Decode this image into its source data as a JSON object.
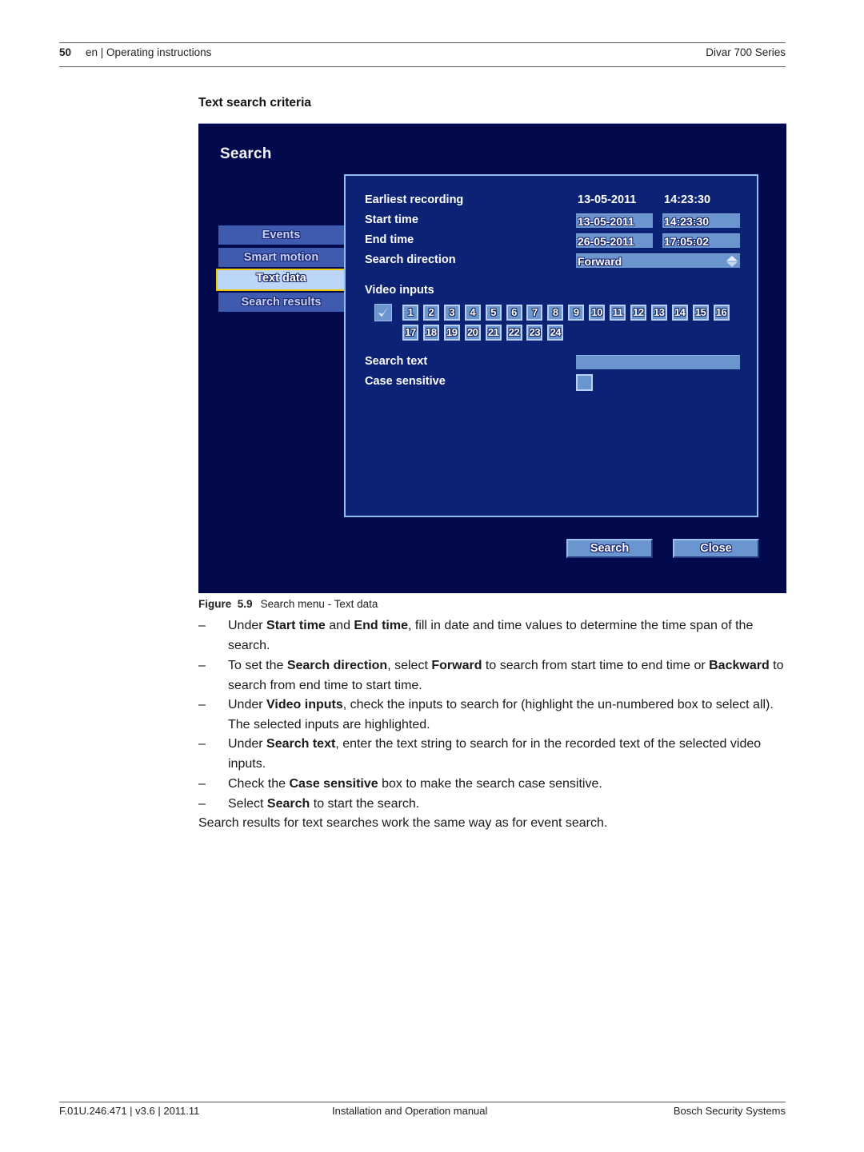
{
  "header": {
    "page_number": "50",
    "section": "en | Operating instructions",
    "product": "Divar 700 Series"
  },
  "section_title": "Text search criteria",
  "dvr_screen": {
    "title": "Search",
    "tabs": [
      {
        "label": "Events",
        "active": false
      },
      {
        "label": "Smart motion",
        "active": false
      },
      {
        "label": "Text data",
        "active": true
      },
      {
        "label": "Search results",
        "active": false
      }
    ],
    "earliest_recording": {
      "label": "Earliest recording",
      "date": "13-05-2011",
      "time": "14:23:30"
    },
    "start_time": {
      "label": "Start time",
      "date": "13-05-2011",
      "time": "14:23:30"
    },
    "end_time": {
      "label": "End time",
      "date": "26-05-2011",
      "time": "17:05:02"
    },
    "search_direction": {
      "label": "Search direction",
      "value": "Forward"
    },
    "video_inputs": {
      "label": "Video inputs",
      "select_all_checked": true,
      "inputs": [
        "1",
        "2",
        "3",
        "4",
        "5",
        "6",
        "7",
        "8",
        "9",
        "10",
        "11",
        "12",
        "13",
        "14",
        "15",
        "16",
        "17",
        "18",
        "19",
        "20",
        "21",
        "22",
        "23",
        "24"
      ]
    },
    "search_text": {
      "label": "Search text",
      "value": ""
    },
    "case_sensitive": {
      "label": "Case sensitive",
      "checked": false
    },
    "buttons": {
      "search": "Search",
      "close": "Close"
    },
    "colors": {
      "background": "#020a4d",
      "panel": "#0c2275",
      "field": "#6b95ce",
      "highlight_border": "#f0c800"
    }
  },
  "figure_caption": {
    "label": "Figure",
    "number": "5.9",
    "text": "Search menu - Text data"
  },
  "bullets": [
    {
      "parts": [
        {
          "t": "Under "
        },
        {
          "b": "Start time"
        },
        {
          "t": " and "
        },
        {
          "b": "End time"
        },
        {
          "t": ", fill in date and time values to determine the time span of the search."
        }
      ]
    },
    {
      "parts": [
        {
          "t": "To set the "
        },
        {
          "b": "Search direction"
        },
        {
          "t": ", select "
        },
        {
          "b": "Forward"
        },
        {
          "t": " to search from start time to end time or "
        },
        {
          "b": "Backward"
        },
        {
          "t": " to search from end time to start time."
        }
      ]
    },
    {
      "parts": [
        {
          "t": "Under "
        },
        {
          "b": "Video inputs"
        },
        {
          "t": ", check the inputs to search for (highlight the un-numbered box to select all). The selected inputs are highlighted."
        }
      ]
    },
    {
      "parts": [
        {
          "t": "Under "
        },
        {
          "b": "Search text"
        },
        {
          "t": ", enter the text string to search for in the recorded text of the selected video inputs."
        }
      ]
    },
    {
      "parts": [
        {
          "t": "Check the "
        },
        {
          "b": "Case sensitive"
        },
        {
          "t": " box to make the search case sensitive."
        }
      ]
    },
    {
      "parts": [
        {
          "t": "Select "
        },
        {
          "b": "Search"
        },
        {
          "t": " to start the search."
        }
      ]
    }
  ],
  "bullet_dash": "–",
  "closing_paragraph": "Search results for text searches work the same way as for event search.",
  "footer": {
    "doc_id": "F.01U.246.471 | v3.6 | 2011.11",
    "manual": "Installation and Operation manual",
    "company": "Bosch Security Systems"
  }
}
